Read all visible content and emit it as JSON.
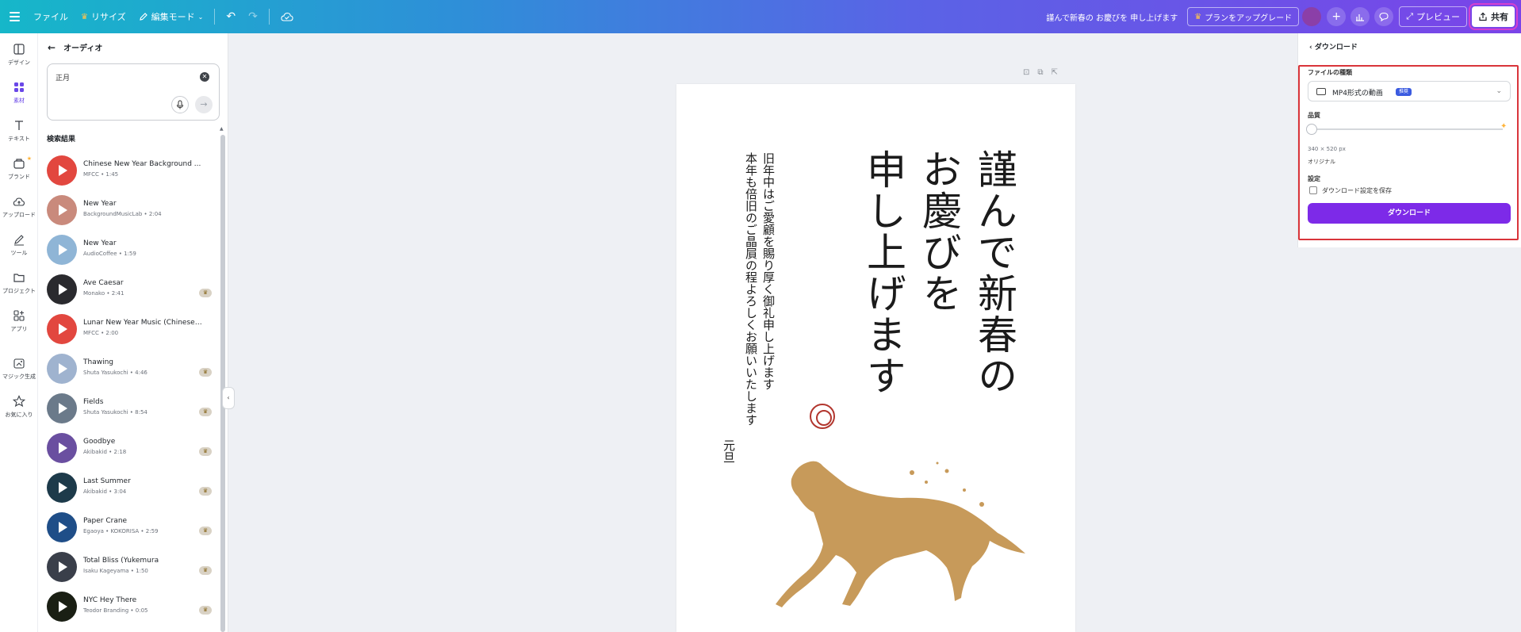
{
  "topbar": {
    "file_label": "ファイル",
    "resize_label": "リサイズ",
    "edit_mode_label": "編集モード",
    "doc_title": "謹んで新春の お慶びを 申し上げます",
    "upgrade_label": "プランをアップグレード",
    "preview_label": "プレビュー",
    "share_label": "共有"
  },
  "rail": {
    "items": [
      {
        "label": "デザイン",
        "icon": "layout-icon"
      },
      {
        "label": "素材",
        "icon": "elements-icon"
      },
      {
        "label": "テキスト",
        "icon": "text-icon"
      },
      {
        "label": "ブランド",
        "icon": "brand-icon"
      },
      {
        "label": "アップロード",
        "icon": "upload-icon"
      },
      {
        "label": "ツール",
        "icon": "draw-icon"
      },
      {
        "label": "プロジェクト",
        "icon": "folder-icon"
      },
      {
        "label": "アプリ",
        "icon": "apps-icon"
      },
      {
        "label": "マジック生成",
        "icon": "magic-icon"
      },
      {
        "label": "お気に入り",
        "icon": "star-icon"
      }
    ]
  },
  "audio_panel": {
    "title": "オーディオ",
    "search_value": "正月",
    "results_title": "検索結果",
    "tracks": [
      {
        "title": "Chinese New Year Background ...",
        "meta": "MFCC • 1:45",
        "pro": false,
        "color": "#e2473f"
      },
      {
        "title": "New Year",
        "meta": "BackgroundMusicLab • 2:04",
        "pro": false,
        "color": "#c98a7c"
      },
      {
        "title": "New Year",
        "meta": "AudioCoffee • 1:59",
        "pro": false,
        "color": "#8fb5d6"
      },
      {
        "title": "Ave Caesar",
        "meta": "Monako • 2:41",
        "pro": true,
        "color": "#2a2a2e"
      },
      {
        "title": "Lunar New Year Music (Chinese ...",
        "meta": "MFCC • 2:00",
        "pro": false,
        "color": "#e2473f"
      },
      {
        "title": "Thawing",
        "meta": "Shuta Yasukochi • 4:46",
        "pro": true,
        "color": "#9fb3cf"
      },
      {
        "title": "Fields",
        "meta": "Shuta Yasukochi • 8:54",
        "pro": true,
        "color": "#6b7a8a"
      },
      {
        "title": "Goodbye",
        "meta": "Akibakid • 2:18",
        "pro": true,
        "color": "#6a4fa0"
      },
      {
        "title": "Last Summer",
        "meta": "Akibakid • 3:04",
        "pro": true,
        "color": "#1d3a4a"
      },
      {
        "title": "Paper Crane",
        "meta": "Egaoya • KOKORISA • 2:59",
        "pro": true,
        "color": "#1f4e88"
      },
      {
        "title": "Total Bliss (Yukemura",
        "meta": "Isaku Kageyama • 1:50",
        "pro": true,
        "color": "#3a3f4a"
      },
      {
        "title": "NYC Hey There",
        "meta": "Teodor Branding • 0:05",
        "pro": true,
        "color": "#1a1f14"
      }
    ]
  },
  "card": {
    "col1": "謹んで新春の",
    "col2": "お慶びを",
    "col3": "申し上げます",
    "col4": "旧年中はご愛顧を賜り厚く御礼申し上げます",
    "col5": "本年も倍旧のご晶屓の程よろしくお願いいたします",
    "col6": "元旦",
    "horse_color": "#c79a5a",
    "seal_color": "#b2362e"
  },
  "download_panel": {
    "back_label": "ダウンロード",
    "file_type_label": "ファイルの種類",
    "file_type_value": "MP4形式の動画",
    "file_type_badge": "推奨",
    "quality_label": "品質",
    "quality_level": 0,
    "size_text": "340 × 520 px",
    "original_label": "オリジナル",
    "settings_label": "設定",
    "save_settings_label": "ダウンロード設定を保存",
    "download_button": "ダウンロード"
  },
  "colors": {
    "accent": "#7d2ae8",
    "highlight": "#d9343a"
  }
}
